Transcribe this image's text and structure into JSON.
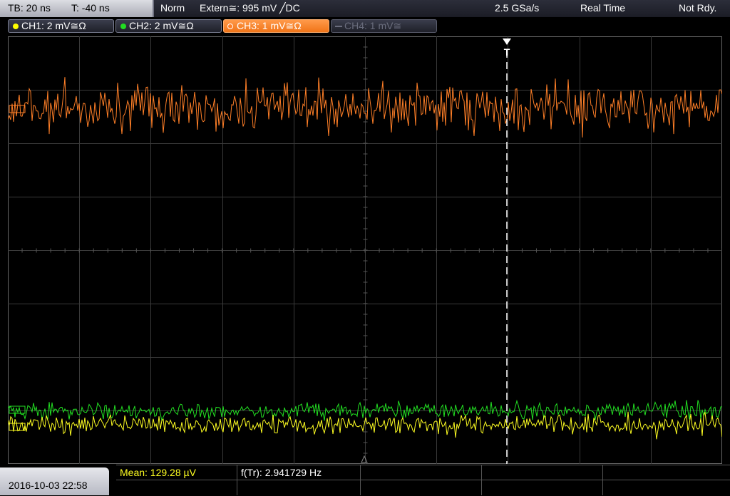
{
  "status_bar": {
    "timebase": "TB: 20 ns",
    "trigger_time": "T: -40 ns",
    "acq_mode": "Norm",
    "trigger_source": "Extern≅: 995 mV ╱DC",
    "sample_rate": "2.5 GSa/s",
    "mode": "Real Time",
    "state": "Not Rdy."
  },
  "channels": [
    {
      "label": "CH1: 2 mV≅Ω",
      "color": "#ffff00",
      "state": "on"
    },
    {
      "label": "CH2: 2 mV≅Ω",
      "color": "#22dd22",
      "state": "on"
    },
    {
      "label": "CH3: 1 mV≅Ω",
      "color": "#ff7f27",
      "state": "active"
    },
    {
      "label": "CH4: 1 mV≅",
      "color": "#6a6d7d",
      "state": "off"
    }
  ],
  "markers": {
    "trigger": "T"
  },
  "colors": {
    "ch1": "#ffff22",
    "ch2": "#22e022",
    "ch3": "#ff7f27",
    "grid": "#3a3a3a"
  },
  "measurements": {
    "mean": "Mean: 129.28 µV",
    "freq": "f(Tr): 2.941729 Hz"
  },
  "datetime": "2016-10-03 22:58"
}
